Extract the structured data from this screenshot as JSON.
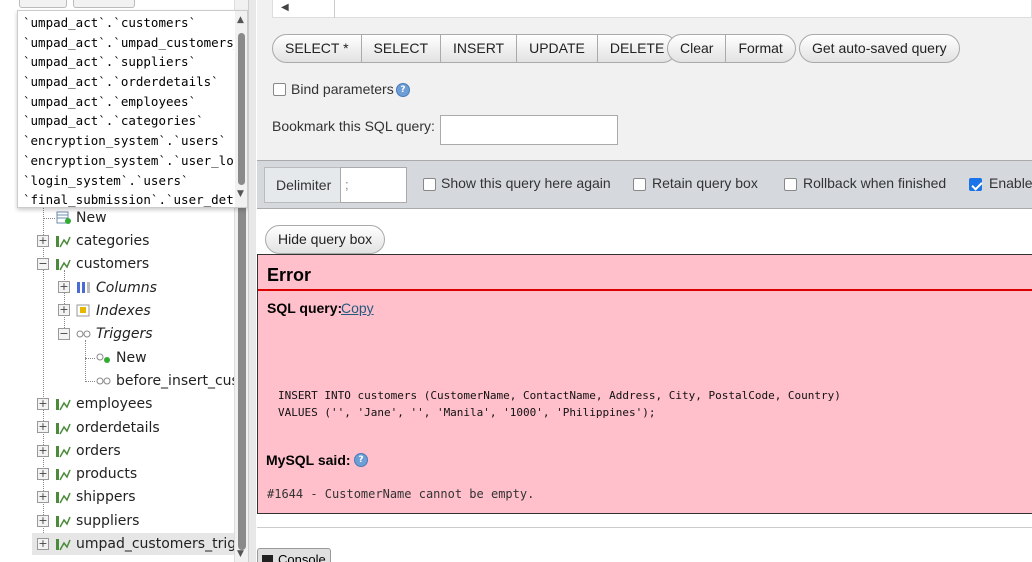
{
  "autocomplete": {
    "items": [
      "`umpad_act`.`customers`",
      "`umpad_act`.`umpad_customers_trigger`",
      "`umpad_act`.`suppliers`",
      "`umpad_act`.`orderdetails`",
      "`umpad_act`.`employees`",
      "`umpad_act`.`categories`",
      "`encryption_system`.`users`",
      "`encryption_system`.`user_logs`",
      "`login_system`.`users`",
      "`final_submission`.`user_details`"
    ]
  },
  "tree": {
    "new_label": "New",
    "tables": {
      "categories": "categories",
      "customers": "customers",
      "employees": "employees",
      "orderdetails": "orderdetails",
      "orders": "orders",
      "products": "products",
      "shippers": "shippers",
      "suppliers": "suppliers",
      "umpad_customers_trigger": "umpad_customers_trigger_"
    },
    "customers_children": {
      "columns": "Columns",
      "indexes": "Indexes",
      "triggers": "Triggers",
      "trigger_new": "New",
      "trigger_item": "before_insert_customers"
    }
  },
  "toolbar": {
    "select_star": "SELECT *",
    "select": "SELECT",
    "insert": "INSERT",
    "update": "UPDATE",
    "delete": "DELETE",
    "clear": "Clear",
    "format": "Format",
    "get_autosaved": "Get auto-saved query"
  },
  "bind_parameters_label": "Bind parameters",
  "bookmark_label": "Bookmark this SQL query:",
  "bookmark_value": "",
  "options": {
    "delimiter_label": "Delimiter",
    "delimiter_value": ";",
    "show_query_label": "Show this query here again",
    "show_query_checked": false,
    "retain_label": "Retain query box",
    "retain_checked": false,
    "rollback_label": "Rollback when finished",
    "rollback_checked": false,
    "enable_label": "Enable",
    "enable_checked": true
  },
  "hide_query_box_label": "Hide query box",
  "error": {
    "title": "Error",
    "sql_query_label": "SQL query:",
    "copy_label": "Copy",
    "query_line1": "INSERT INTO customers (CustomerName, ContactName, Address, City, PostalCode, Country)",
    "query_line2": "VALUES ('', 'Jane', '', 'Manila', '1000', 'Philippines');",
    "mysql_said_label": "MySQL said:",
    "message": "#1644 - CustomerName cannot be empty."
  },
  "console_label": "Console",
  "colors": {
    "error_bg": "#ffc0cb",
    "error_rule": "#dd0000",
    "link": "#235a81",
    "checkbox_checked": "#1a73e8"
  }
}
